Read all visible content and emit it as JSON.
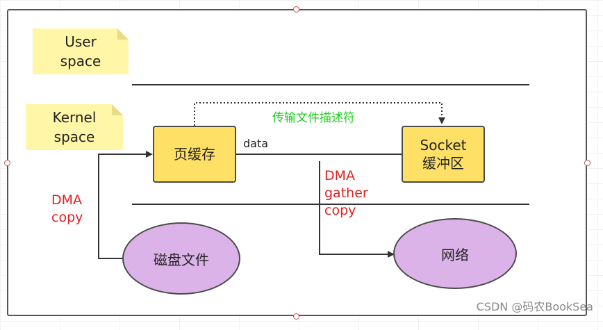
{
  "notes": {
    "user_space": [
      "User",
      "space"
    ],
    "kernel_space": [
      "Kernel",
      "space"
    ]
  },
  "boxes": {
    "page_cache": "页缓存",
    "socket_buffer": [
      "Socket",
      "缓冲区"
    ]
  },
  "ellipses": {
    "disk_file": "磁盘文件",
    "network": "网络"
  },
  "labels": {
    "dma_copy": [
      "DMA",
      "copy"
    ],
    "dma_gather_copy": [
      "DMA",
      "gather",
      "copy"
    ],
    "data": "data",
    "transfer_fd": "传输文件描述符"
  },
  "watermark": "CSDN @码农BookSea",
  "colors": {
    "note_fill": "#fff6a8",
    "box_fill": "#ffe066",
    "ellipse_fill": "#dcb3e8",
    "dma_label": "#e02020",
    "descriptor_label": "#22cc22"
  }
}
